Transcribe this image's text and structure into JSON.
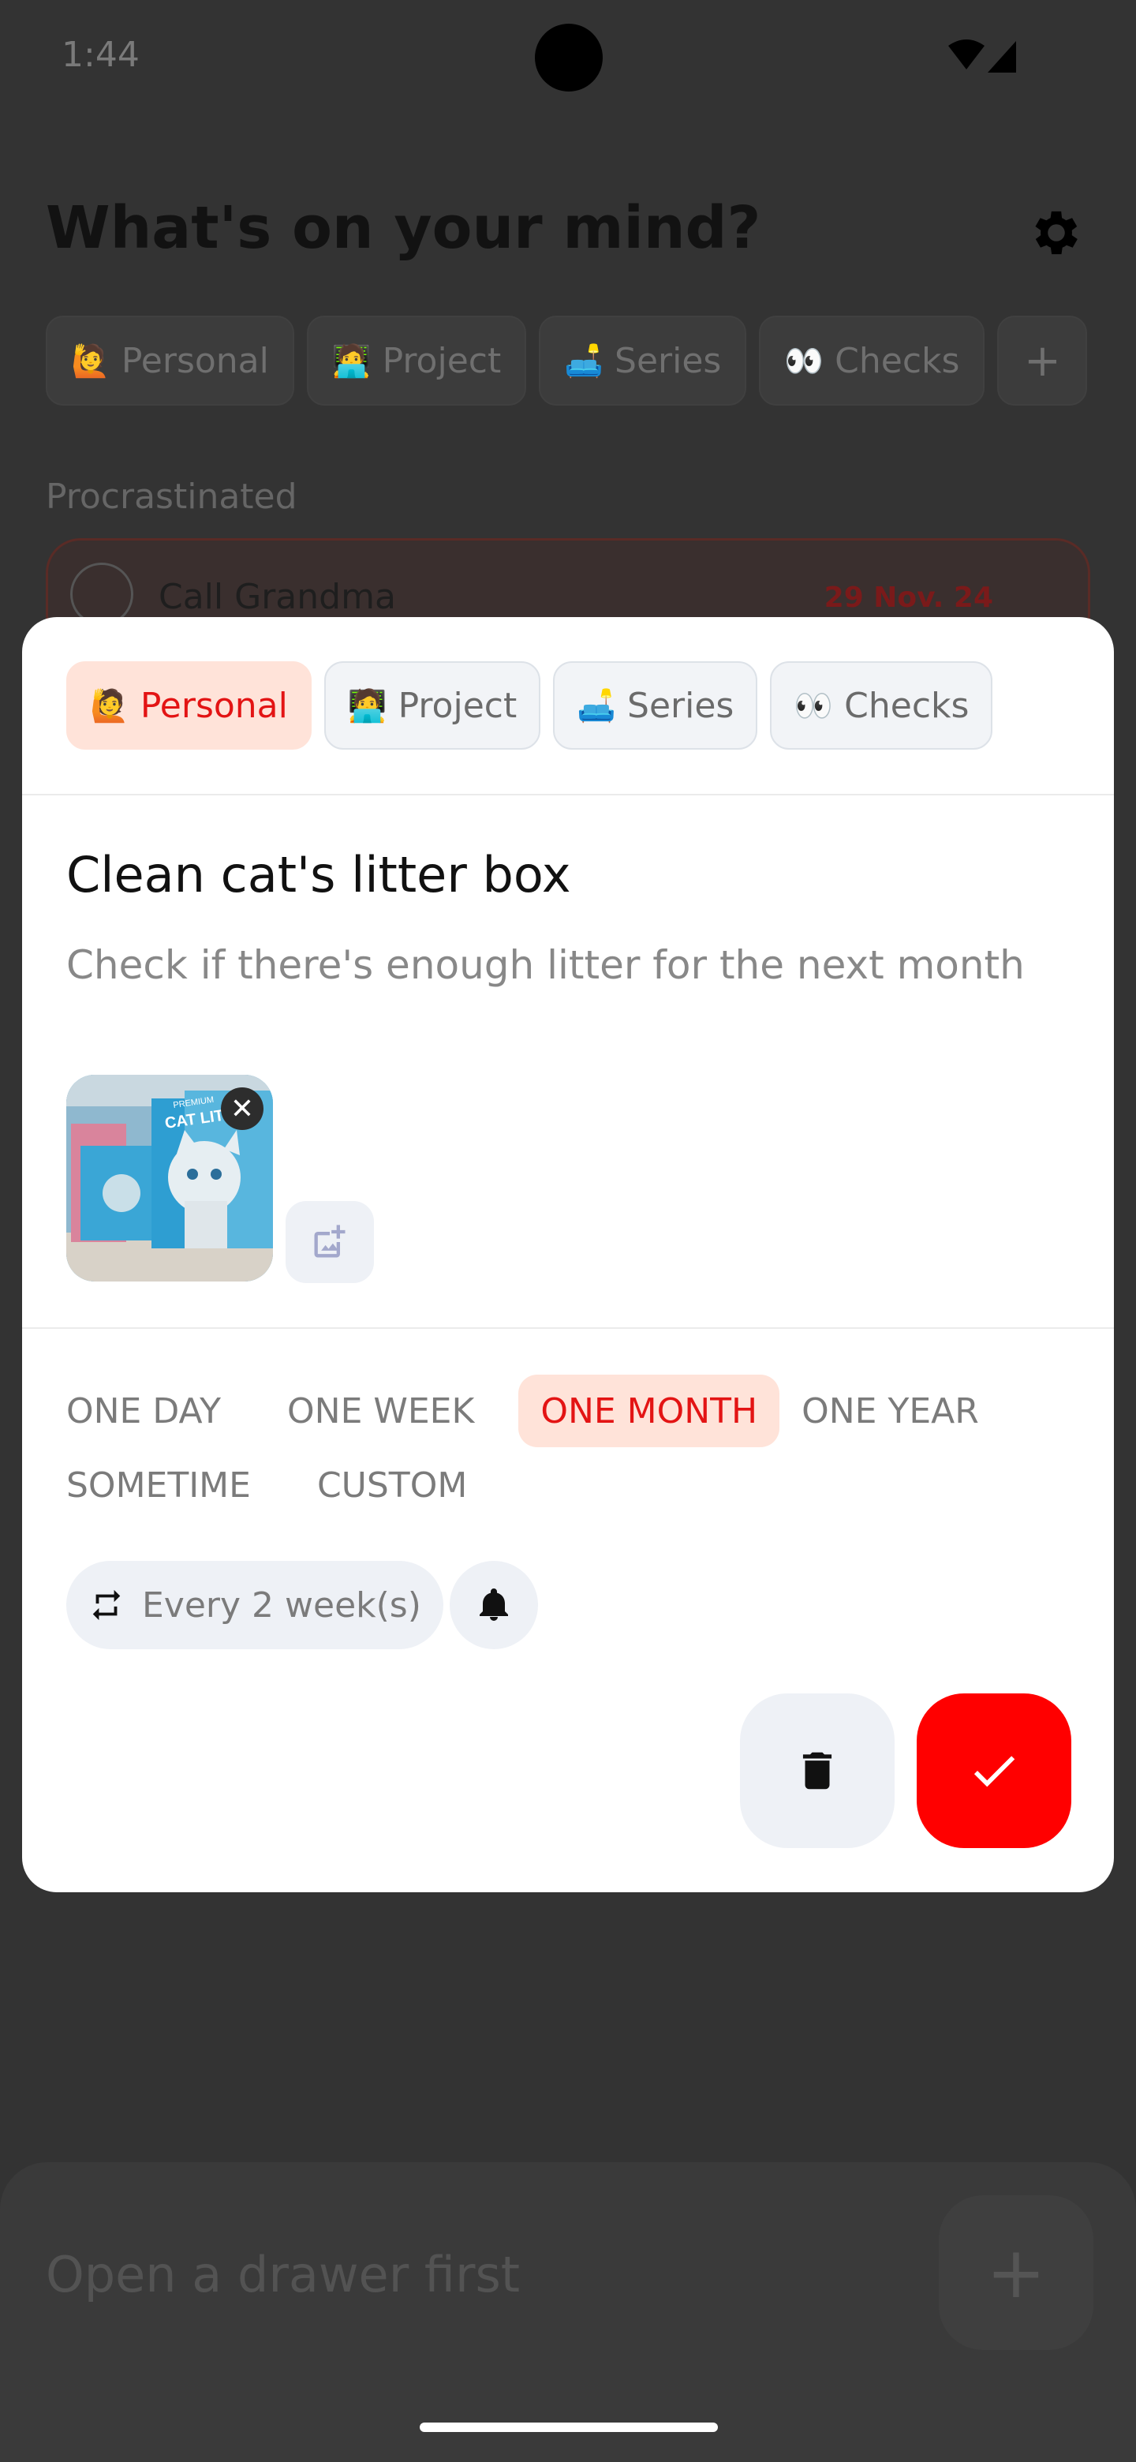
{
  "status_bar": {
    "time": "1:44"
  },
  "background": {
    "title": "What's on your mind?",
    "chips": [
      {
        "emoji": "🙋",
        "label": "Personal"
      },
      {
        "emoji": "🧑‍💻",
        "label": "Project"
      },
      {
        "emoji": "🛋️",
        "label": "Series"
      },
      {
        "emoji": "👀",
        "label": "Checks"
      }
    ],
    "add_chip": "+",
    "section": "Procrastinated",
    "item": {
      "title": "Call Grandma",
      "date": "29 Nov. 24"
    },
    "input_placeholder": "Open a drawer first",
    "fab": "+"
  },
  "dialog": {
    "drawers": [
      {
        "emoji": "🙋",
        "label": "Personal",
        "selected": true
      },
      {
        "emoji": "🧑‍💻",
        "label": "Project",
        "selected": false
      },
      {
        "emoji": "🛋️",
        "label": "Series",
        "selected": false
      },
      {
        "emoji": "👀",
        "label": "Checks",
        "selected": false
      }
    ],
    "task_title": "Clean cat's litter box",
    "task_description": "Check if there's enough litter for the next month",
    "image_text": {
      "brand": "PREMIUM",
      "product": "CAT LITTER"
    },
    "due_options_row1": [
      "ONE DAY",
      "ONE WEEK",
      "ONE MONTH",
      "ONE YEAR"
    ],
    "due_options_row2": [
      "SOMETIME",
      "CUSTOM"
    ],
    "selected_due": "ONE MONTH",
    "repeat_label": "Every 2 week(s)"
  },
  "colors": {
    "accent": "#ff0000",
    "accent_soft": "#ffe3d9",
    "accent_text": "#e31414"
  }
}
